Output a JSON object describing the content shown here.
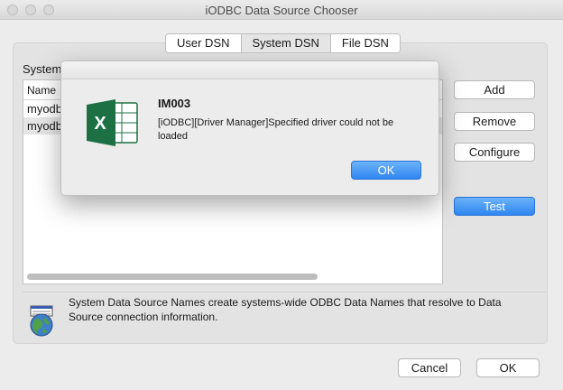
{
  "window": {
    "title": "iODBC Data Source Chooser"
  },
  "tabs": [
    {
      "label": "User DSN"
    },
    {
      "label": "System DSN"
    },
    {
      "label": "File DSN"
    }
  ],
  "system_dsn": {
    "group_label": "System",
    "list": {
      "column_header": "Name",
      "rows": [
        "myodb",
        "myodb"
      ]
    },
    "buttons": {
      "add": "Add",
      "remove": "Remove",
      "configure": "Configure",
      "test": "Test"
    },
    "info_text": "System Data Source Names create systems-wide ODBC Data Names that resolve to Data Source connection information."
  },
  "footer": {
    "cancel": "Cancel",
    "ok": "OK"
  },
  "alert": {
    "title": "IM003",
    "message": "[iODBC][Driver Manager]Specified driver could not be loaded",
    "ok": "OK",
    "icon": "excel-icon"
  },
  "colors": {
    "accent": "#2f86f0",
    "excel_green": "#1d7044"
  }
}
